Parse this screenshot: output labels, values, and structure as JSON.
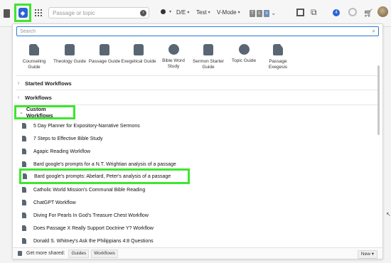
{
  "toolbar": {
    "passage_placeholder": "Passage or topic",
    "reference_filter": "D/E",
    "text_filter": "Test",
    "mode": "V-Mode",
    "panel_buttons": [
      "T",
      "L",
      "≡"
    ],
    "notification_count": "4"
  },
  "panel": {
    "search_placeholder": "Search",
    "guides": [
      {
        "label": "Counseling Guide",
        "icon": "counseling-guide-icon"
      },
      {
        "label": "Theology Guide",
        "icon": "theology-guide-icon"
      },
      {
        "label": "Passage Guide",
        "icon": "passage-guide-icon"
      },
      {
        "label": "Exegetical Guide",
        "icon": "exegetical-guide-icon"
      },
      {
        "label": "Bible Word Study",
        "icon": "bible-word-study-icon"
      },
      {
        "label": "Sermon Starter Guide",
        "icon": "sermon-starter-guide-icon"
      },
      {
        "label": "Topic Guide",
        "icon": "topic-guide-icon"
      },
      {
        "label": "Passage Exegesis",
        "icon": "passage-exegesis-icon"
      }
    ],
    "sections": {
      "started": "Started Workflows",
      "workflows": "Workflows",
      "custom": "Custom Workflows"
    },
    "workflows": [
      "5 Day Planner for Expository-Narrative Sermons",
      "7 Steps  to Effective Bible Study",
      "Agapic Reading Workflow",
      "Bard google's prompts for a N.T. Wrightian analysis of a passage",
      "Bard google's prompts: Abelard, Peter's analysis of a passage",
      "Catholic World Mission's Communal Bible Reading",
      "ChatGPT Workflow",
      "Diving For Pearls In God's Treasure Chest Workflow",
      "Does Passage X Really Support Doctrine Y? Workflow",
      "Donald S. Whitney's Ask the Philippians 4:8 Questions"
    ],
    "footer": {
      "label": "Get more shared:",
      "chips": [
        "Guides",
        "Workflows"
      ],
      "new_button": "New"
    }
  },
  "colors": {
    "accent": "#2a64d6",
    "highlight": "#3ee62e"
  }
}
